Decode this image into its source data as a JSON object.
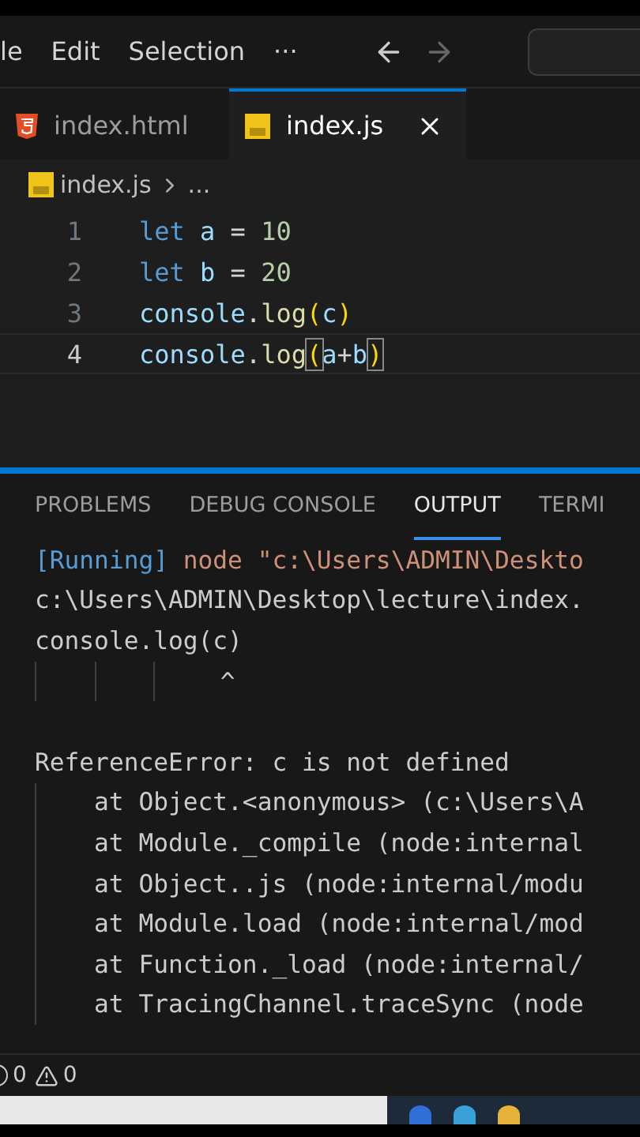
{
  "menu": {
    "items": [
      "le",
      "Edit",
      "Selection",
      "···"
    ]
  },
  "tabs": [
    {
      "label": "index.html",
      "selected": false
    },
    {
      "label": "index.js",
      "selected": true
    }
  ],
  "breadcrumb": [
    "index.js",
    "..."
  ],
  "editor": {
    "lines": [
      {
        "number": "1",
        "current": false,
        "tokens": [
          {
            "t": "let ",
            "kind": "keyword"
          },
          {
            "t": "a ",
            "kind": "variable"
          },
          {
            "t": "= ",
            "kind": "operator"
          },
          {
            "t": "10",
            "kind": "number"
          }
        ]
      },
      {
        "number": "2",
        "current": false,
        "tokens": [
          {
            "t": "let ",
            "kind": "keyword"
          },
          {
            "t": "b ",
            "kind": "variable"
          },
          {
            "t": "= ",
            "kind": "operator"
          },
          {
            "t": "20",
            "kind": "number"
          }
        ]
      },
      {
        "number": "3",
        "current": false,
        "tokens": [
          {
            "t": "console",
            "kind": "variable"
          },
          {
            "t": ".",
            "kind": "operator"
          },
          {
            "t": "log",
            "kind": "function"
          },
          {
            "t": "(",
            "kind": "bracket",
            "matched": false
          },
          {
            "t": "c",
            "kind": "variable"
          },
          {
            "t": ")",
            "kind": "bracket",
            "matched": false
          }
        ]
      },
      {
        "number": "4",
        "current": true,
        "tokens": [
          {
            "t": "console",
            "kind": "variable"
          },
          {
            "t": ".",
            "kind": "operator"
          },
          {
            "t": "log",
            "kind": "function"
          },
          {
            "t": "(",
            "kind": "bracket",
            "matched": true
          },
          {
            "t": "a",
            "kind": "variable"
          },
          {
            "t": "+",
            "kind": "operator"
          },
          {
            "t": "b",
            "kind": "variable"
          },
          {
            "t": ")",
            "kind": "bracket",
            "matched": true
          }
        ]
      }
    ]
  },
  "panel": {
    "tabs": [
      {
        "label": "PROBLEMS",
        "selected": false
      },
      {
        "label": "DEBUG CONSOLE",
        "selected": false
      },
      {
        "label": "OUTPUT",
        "selected": true
      },
      {
        "label": "TERMI",
        "selected": false
      }
    ],
    "output": [
      {
        "kind": "running",
        "tag": "[Running]",
        "text": " node \"c:\\Users\\ADMIN\\Deskto"
      },
      {
        "kind": "text",
        "text": "c:\\Users\\ADMIN\\Desktop\\lecture\\index."
      },
      {
        "kind": "text",
        "text": "console.log(c)"
      },
      {
        "kind": "caret",
        "text": "^"
      },
      {
        "kind": "error",
        "text": "ReferenceError: c is not defined"
      },
      {
        "kind": "stack",
        "text": "at Object.<anonymous> (c:\\Users\\A"
      },
      {
        "kind": "stack",
        "text": "at Module._compile (node:internal"
      },
      {
        "kind": "stack",
        "text": "at Object..js (node:internal/modu"
      },
      {
        "kind": "stack",
        "text": "at Module.load (node:internal/mod"
      },
      {
        "kind": "stack",
        "text": "at Function._load (node:internal/"
      },
      {
        "kind": "stack",
        "text": "at TracingChannel.traceSync (node"
      }
    ]
  },
  "status_bar": {
    "errors": "0",
    "warnings": "0"
  }
}
